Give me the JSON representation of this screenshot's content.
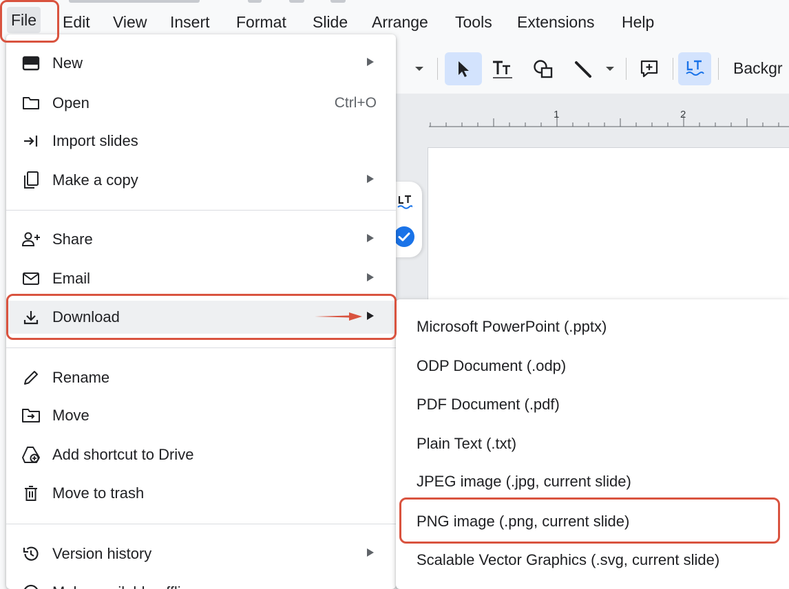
{
  "menubar": {
    "items": [
      "File",
      "Edit",
      "View",
      "Insert",
      "Format",
      "Slide",
      "Arrange",
      "Tools",
      "Extensions",
      "Help"
    ]
  },
  "toolbar": {
    "background_label": "Backgr"
  },
  "ruler": {
    "numbers": [
      "1",
      "2"
    ]
  },
  "file_menu": {
    "items": [
      {
        "label": "New",
        "icon": "new-slides-icon",
        "submenu": true
      },
      {
        "label": "Open",
        "icon": "folder-icon",
        "shortcut": "Ctrl+O"
      },
      {
        "label": "Import slides",
        "icon": "import-icon"
      },
      {
        "label": "Make a copy",
        "icon": "copy-icon",
        "submenu": true
      },
      {
        "label": "Share",
        "icon": "person-add-icon",
        "submenu": true
      },
      {
        "label": "Email",
        "icon": "mail-icon",
        "submenu": true
      },
      {
        "label": "Download",
        "icon": "download-icon",
        "submenu": true,
        "highlighted": true
      },
      {
        "label": "Rename",
        "icon": "pencil-icon"
      },
      {
        "label": "Move",
        "icon": "move-folder-icon"
      },
      {
        "label": "Add shortcut to Drive",
        "icon": "drive-shortcut-icon"
      },
      {
        "label": "Move to trash",
        "icon": "trash-icon"
      },
      {
        "label": "Version history",
        "icon": "history-icon",
        "submenu": true
      },
      {
        "label": "Make available offline",
        "icon": "offline-icon"
      }
    ]
  },
  "download_submenu": {
    "items": [
      "Microsoft PowerPoint (.pptx)",
      "ODP Document (.odp)",
      "PDF Document (.pdf)",
      "Plain Text (.txt)",
      "JPEG image (.jpg, current slide)",
      "PNG image (.png, current slide)",
      "Scalable Vector Graphics (.svg, current slide)"
    ]
  },
  "colors": {
    "annotation": "#d9533f",
    "active_tool": "#d3e3fd",
    "accent_blue": "#1a73e8",
    "menu_highlight": "#eef0f2"
  }
}
